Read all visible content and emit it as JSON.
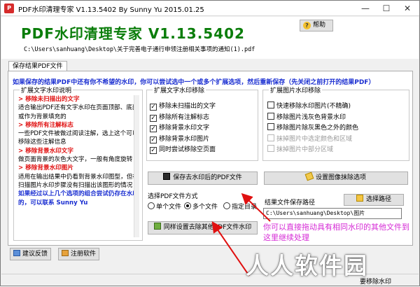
{
  "window": {
    "title": "PDF水印清理专家 V1.13.5402 By Sunny Yu 2015.01.25",
    "minimize": "—",
    "maximize": "☐",
    "close": "✕"
  },
  "header": {
    "app_title": "PDF水印清理专家 V1.13.5402",
    "help_label": "帮助",
    "file_path": "C:\\Users\\sanhuang\\Desktop\\关于完善电子通行申领注册相关事项的通知(1).pdf"
  },
  "tab": {
    "label": "保存结果PDF文件"
  },
  "notice": "如果保存的结果PDF中还有你不希望的水印，你可以尝试选中一个或多个扩展选项，然后重新保存（先关闭之前打开的结果PDF）",
  "help_group": {
    "legend": "扩展文字水印说明",
    "items": [
      {
        "heading": "> 移除未扫描出的文字",
        "text": "适合输出PDF还有文字水印在页面顶部、底部或作为背景填充的"
      },
      {
        "heading": "> 移除所有注解标志",
        "text": "一些PDF文件被做过阅读注解，选上这个可以移除这些注解信息"
      },
      {
        "heading": "> 移除背景水印文字",
        "text": "做页面背景的灰色大文字，一般有角度旋转"
      },
      {
        "heading": "> 移除背景水印图片",
        "text": "适用在输出结果中仍看到背景水印图型，但在扫描图片水印步骤没有扫描出该图形的情况"
      },
      {
        "heading": "如果经过以上几个选项的组合尝试仍存在水印的，可以联系 Sunny Yu",
        "text": ""
      }
    ]
  },
  "text_group": {
    "legend": "扩展文字水印移除",
    "options": [
      {
        "label": "移除未扫描出的文字",
        "checked": true
      },
      {
        "label": "移除所有注解标志",
        "checked": true
      },
      {
        "label": "移除背景水印文字",
        "checked": true
      },
      {
        "label": "移除背景水印图片",
        "checked": true
      },
      {
        "label": "同时尝试移除空页面",
        "checked": true
      }
    ]
  },
  "image_group": {
    "legend": "扩展图片水印移除",
    "options": [
      {
        "label": "快速移除水印图片(不精确)",
        "checked": false,
        "enabled": true
      },
      {
        "label": "移除图片浅灰色背景水印",
        "checked": false,
        "enabled": true
      },
      {
        "label": "移除图片除灰黑色之外的颜色",
        "checked": false,
        "enabled": true
      },
      {
        "label": "抹掉图片中选定颜色和区域",
        "checked": false,
        "enabled": false
      },
      {
        "label": "抹掉图片中部分区域",
        "checked": false,
        "enabled": false
      }
    ]
  },
  "actions": {
    "save_label": "保存去水印后的PDF文件",
    "image_options_label": "设置图像抹除选项",
    "apply_others_label": "同样设置去除其他PDF文件水印",
    "select_path_label": "选择路径"
  },
  "mode": {
    "legend": "选择PDF文件方式",
    "options": [
      {
        "label": "单个文件",
        "selected": false
      },
      {
        "label": "多个文件",
        "selected": true
      },
      {
        "label": "指定目录",
        "selected": false
      }
    ]
  },
  "output": {
    "legend": "结果文件保存路径",
    "path": "C:\\Users\\sanhuang\\Desktop\\图片"
  },
  "tip": "你可以直接拖动具有相同水印的其他文件到这里继续处理",
  "bottom": {
    "feedback_label": "建议反馈",
    "register_label": "注册软件"
  },
  "status": {
    "text": "要移除水印"
  },
  "watermark": "人人软件园",
  "colors": {
    "title_green": "#0a7d0a",
    "notice_blue": "#1a2ed1",
    "heading_red": "#e01010",
    "tip_magenta": "#d62bd6",
    "arrow_red": "#e01010"
  }
}
